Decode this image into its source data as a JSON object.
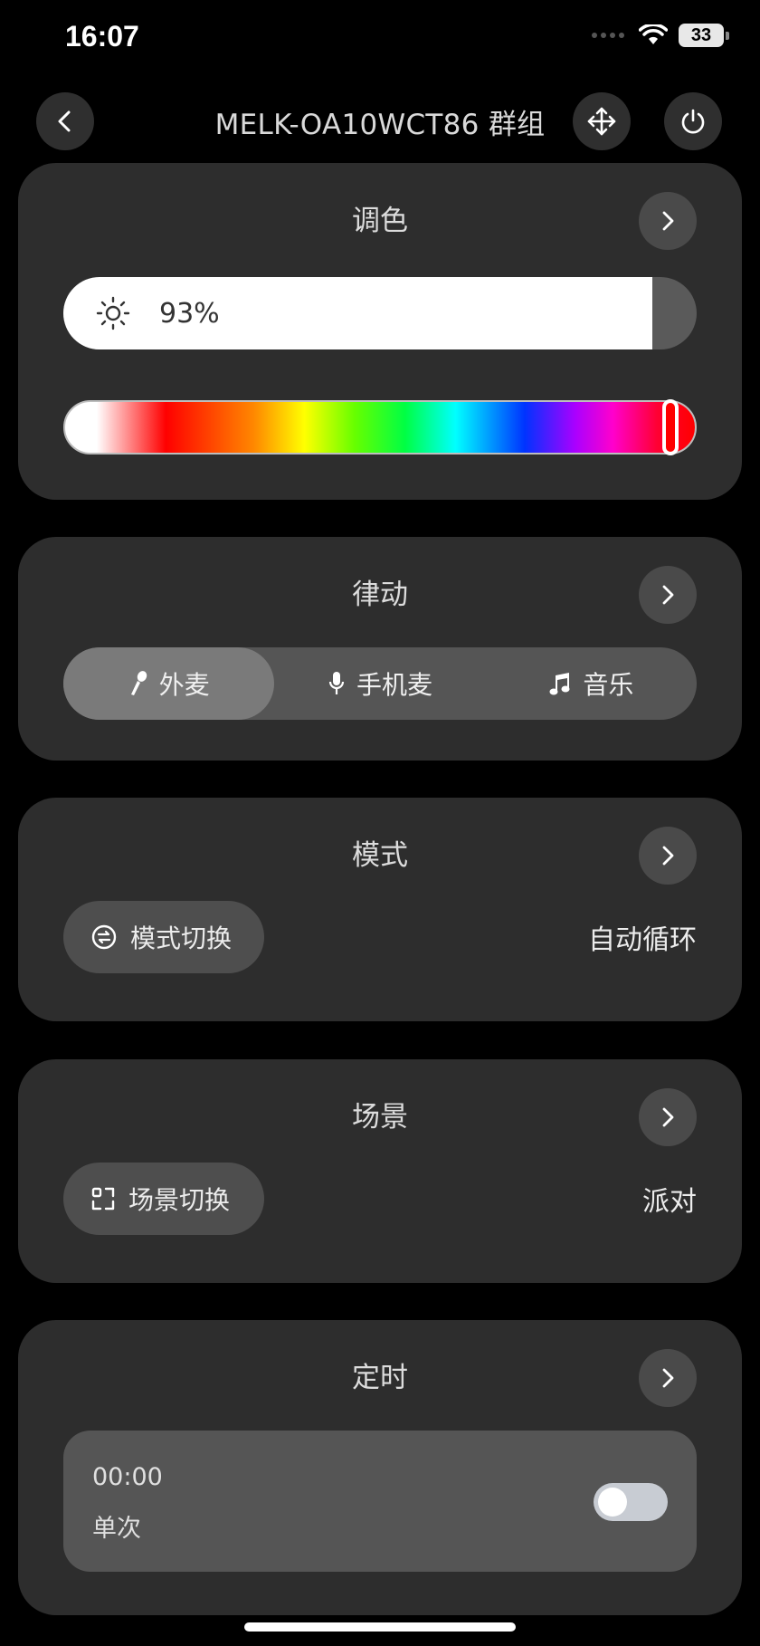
{
  "status_bar": {
    "time": "16:07",
    "battery": "33"
  },
  "header": {
    "title": "MELK-OA10WCT86 群组"
  },
  "color_card": {
    "title": "调色",
    "brightness_percent": 93,
    "brightness_label": "93%",
    "hue_position": 0.97
  },
  "rhythm_card": {
    "title": "律动",
    "options": [
      {
        "label": "外麦",
        "icon": "external-mic-icon",
        "active": true
      },
      {
        "label": "手机麦",
        "icon": "microphone-icon",
        "active": false
      },
      {
        "label": "音乐",
        "icon": "music-note-icon",
        "active": false
      }
    ]
  },
  "mode_card": {
    "title": "模式",
    "switch_label": "模式切换",
    "current": "自动循环"
  },
  "scene_card": {
    "title": "场景",
    "switch_label": "场景切换",
    "current": "派对"
  },
  "timer_card": {
    "title": "定时",
    "time": "00:00",
    "repeat": "单次",
    "enabled": false
  },
  "colors": {
    "background": "#000000",
    "card": "#2d2d2d",
    "segment": "#555555",
    "segment_active": "#7a7a7a"
  }
}
